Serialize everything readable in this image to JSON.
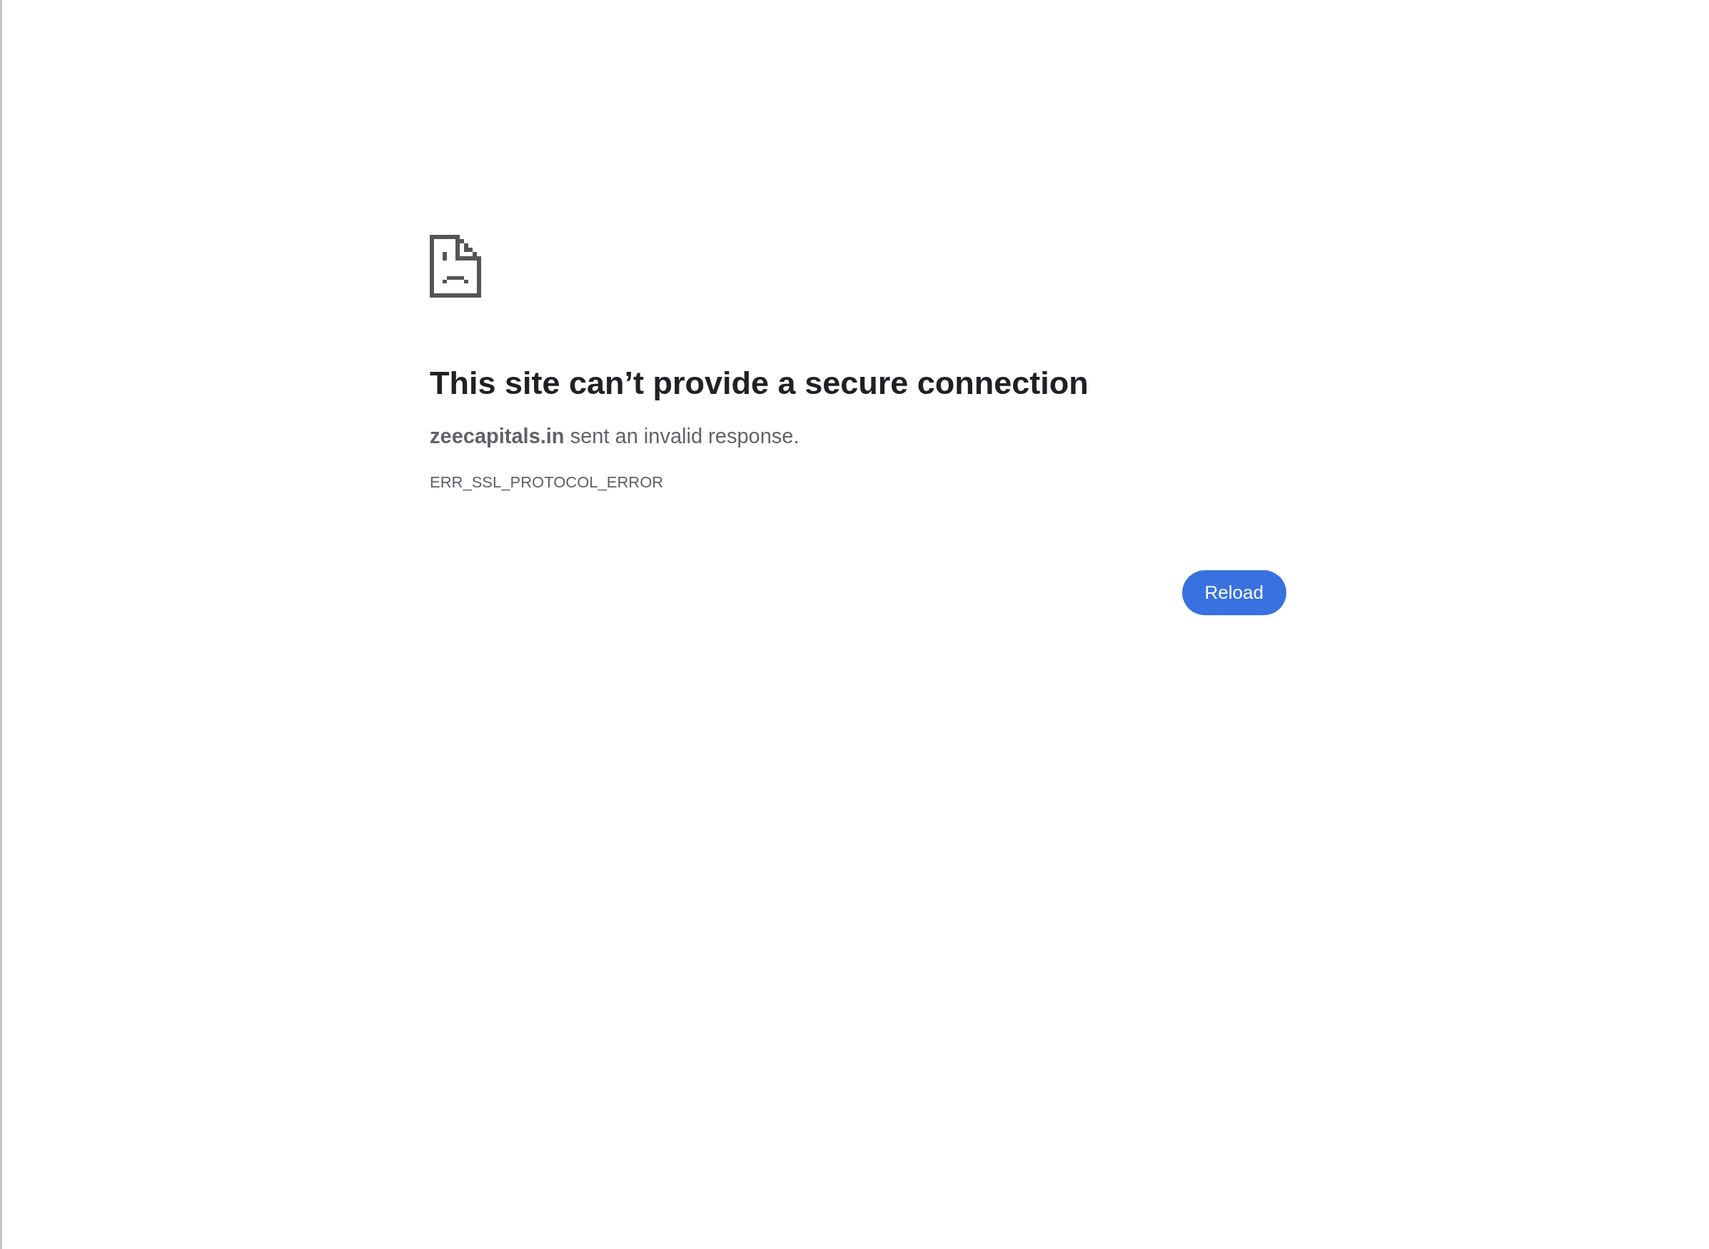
{
  "error_page": {
    "title": "This site can’t provide a secure connection",
    "message": "**zeecapitals.in** sent an invalid response.",
    "error_code": "ERR_SSL_PROTOCOL_ERROR",
    "buttons": [
      {
        "label": "Reload"
      }
    ]
  }
}
